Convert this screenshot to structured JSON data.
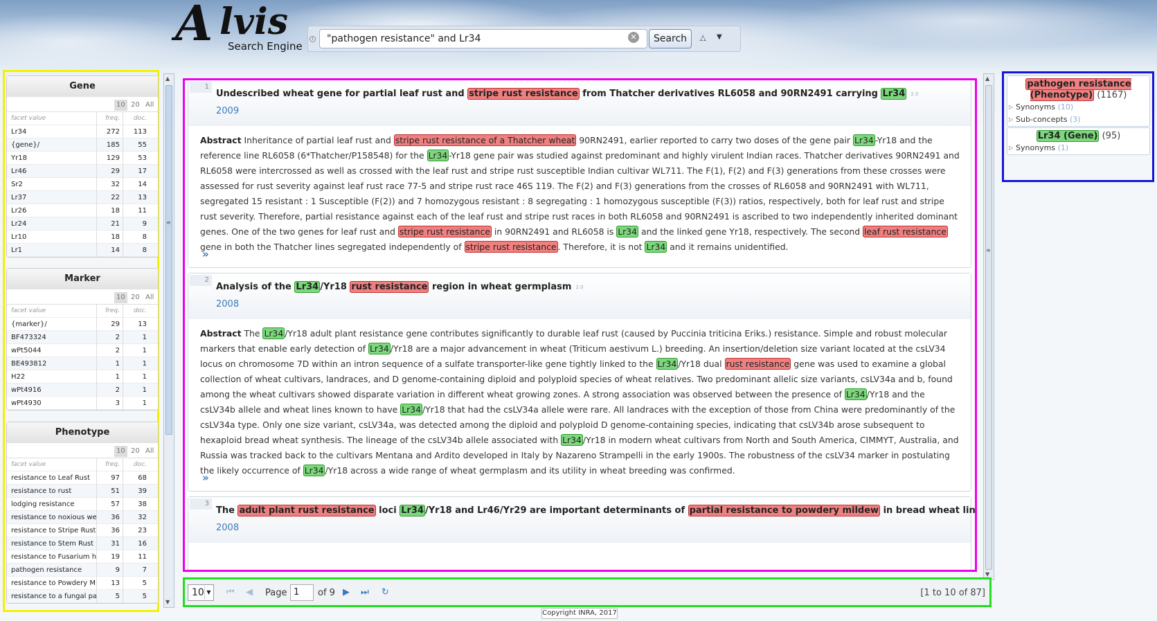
{
  "app": {
    "logo_letter": "A",
    "logo_word": "lvis",
    "logo_sub": "Search Engine"
  },
  "search": {
    "query": "\"pathogen resistance\" and Lr34",
    "button": "Search",
    "info_icon": "info-icon",
    "clear_icon": "clear-icon",
    "tree_icon": "hierarchy-icon"
  },
  "facets": [
    {
      "title": "Gene",
      "toggles": [
        "10",
        "20",
        "All"
      ],
      "headers": [
        "facet value",
        "freq.",
        "doc."
      ],
      "rows": [
        [
          "Lr34",
          "272",
          "113"
        ],
        [
          "{gene}/",
          "185",
          "55"
        ],
        [
          "Yr18",
          "129",
          "53"
        ],
        [
          "Lr46",
          "29",
          "17"
        ],
        [
          "Sr2",
          "32",
          "14"
        ],
        [
          "Lr37",
          "22",
          "13"
        ],
        [
          "Lr26",
          "18",
          "11"
        ],
        [
          "Lr24",
          "21",
          "9"
        ],
        [
          "Lr10",
          "18",
          "8"
        ],
        [
          "Lr1",
          "14",
          "8"
        ]
      ]
    },
    {
      "title": "Marker",
      "toggles": [
        "10",
        "20",
        "All"
      ],
      "headers": [
        "facet value",
        "freq.",
        "doc."
      ],
      "rows": [
        [
          "{marker}/",
          "29",
          "13"
        ],
        [
          "BF473324",
          "2",
          "1"
        ],
        [
          "wPt5044",
          "2",
          "1"
        ],
        [
          "BE493812",
          "1",
          "1"
        ],
        [
          "H22",
          "1",
          "1"
        ],
        [
          "wPt4916",
          "2",
          "1"
        ],
        [
          "wPt4930",
          "3",
          "1"
        ]
      ]
    },
    {
      "title": "Phenotype",
      "toggles": [
        "10",
        "20",
        "All"
      ],
      "headers": [
        "facet value",
        "freq.",
        "doc."
      ],
      "rows": [
        [
          "resistance to Leaf Rust",
          "97",
          "68"
        ],
        [
          "resistance to rust",
          "51",
          "39"
        ],
        [
          "lodging resistance",
          "57",
          "38"
        ],
        [
          "resistance to noxious wee",
          "36",
          "32"
        ],
        [
          "resistance to Stripe Rust",
          "36",
          "23"
        ],
        [
          "resistance to Stem Rust",
          "31",
          "16"
        ],
        [
          "resistance to Fusarium he",
          "19",
          "11"
        ],
        [
          "pathogen resistance",
          "9",
          "7"
        ],
        [
          "resistance to Powdery Mi",
          "13",
          "5"
        ],
        [
          "resistance to a fungal pat",
          "5",
          "5"
        ]
      ]
    }
  ],
  "documents": [
    {
      "num": "1",
      "title_parts": [
        {
          "t": "Undescribed wheat gene for partial leaf rust and ",
          "h": ""
        },
        {
          "t": "stripe rust resistance",
          "h": "r"
        },
        {
          "t": " from Thatcher derivatives RL6058 and 90RN2491 carrying ",
          "h": ""
        },
        {
          "t": "Lr34",
          "h": "g"
        }
      ],
      "score": "2.0",
      "year": "2009",
      "abstract_label": "Abstract",
      "abstract_parts": [
        {
          "t": " Inheritance of partial leaf rust and ",
          "h": ""
        },
        {
          "t": "stripe rust resistance of a Thatcher wheat",
          "h": "r"
        },
        {
          "t": " 90RN2491, earlier reported to carry two doses of the gene pair ",
          "h": ""
        },
        {
          "t": "Lr34",
          "h": "g"
        },
        {
          "t": "-Yr18 and the reference line RL6058 (6*Thatcher/P158548) for the ",
          "h": ""
        },
        {
          "t": "Lr34",
          "h": "g"
        },
        {
          "t": "-Yr18 gene pair was studied against predominant and highly virulent Indian races. Thatcher derivatives 90RN2491 and RL6058 were intercrossed as well as crossed with the leaf rust and stripe rust susceptible Indian cultivar WL711. The F(1), F(2) and F(3) generations from these crosses were assessed for rust severity against leaf rust race 77-5 and stripe rust race 46S 119. The F(2) and F(3) generations from the crosses of RL6058 and 90RN2491 with WL711, segregated 15 resistant : 1 Susceptible (F(2)) and 7 homozygous resistant : 8 segregating : 1 homozygous susceptible (F(3)) ratios, respectively, both for leaf rust and stripe rust severity. Therefore, partial resistance against each of the leaf rust and stripe rust races in both RL6058 and 90RN2491 is ascribed to two independently inherited dominant genes. One of the two genes for leaf rust and ",
          "h": ""
        },
        {
          "t": "stripe rust resistance",
          "h": "r"
        },
        {
          "t": " in 90RN2491 and RL6058 is ",
          "h": ""
        },
        {
          "t": "Lr34",
          "h": "g"
        },
        {
          "t": " and the linked gene Yr18, respectively. The second ",
          "h": ""
        },
        {
          "t": "leaf rust resistance",
          "h": "r"
        },
        {
          "t": " gene in both the Thatcher lines segregated independently of ",
          "h": ""
        },
        {
          "t": "stripe rust resistance",
          "h": "r"
        },
        {
          "t": ". Therefore, it is not ",
          "h": ""
        },
        {
          "t": "Lr34",
          "h": "g"
        },
        {
          "t": " and it remains unidentified.",
          "h": ""
        }
      ]
    },
    {
      "num": "2",
      "title_parts": [
        {
          "t": "Analysis of the ",
          "h": ""
        },
        {
          "t": "Lr34",
          "h": "g"
        },
        {
          "t": "/Yr18 ",
          "h": ""
        },
        {
          "t": "rust resistance",
          "h": "r"
        },
        {
          "t": " region in wheat germplasm",
          "h": ""
        }
      ],
      "score": "2.0",
      "year": "2008",
      "abstract_label": "Abstract",
      "abstract_parts": [
        {
          "t": " The ",
          "h": ""
        },
        {
          "t": "Lr34",
          "h": "g"
        },
        {
          "t": "/Yr18 adult plant resistance gene contributes significantly to durable leaf rust (caused by Puccinia triticina Eriks.) resistance. Simple and robust molecular markers that enable early detection of ",
          "h": ""
        },
        {
          "t": "Lr34",
          "h": "g"
        },
        {
          "t": "/Yr18 are a major advancement in wheat (Triticum aestivum L.) breeding. An insertion/deletion size variant located at the csLV34 locus on chromosome 7D within an intron sequence of a sulfate transporter-like gene tightly linked to the ",
          "h": ""
        },
        {
          "t": "Lr34",
          "h": "g"
        },
        {
          "t": "/Yr18 dual ",
          "h": ""
        },
        {
          "t": "rust resistance",
          "h": "r"
        },
        {
          "t": " gene was used to examine a global collection of wheat cultivars, landraces, and D genome-containing diploid and polyploid species of wheat relatives. Two predominant allelic size variants, csLV34a and b, found among the wheat cultivars showed disparate variation in different wheat growing zones. A strong association was observed between the presence of ",
          "h": ""
        },
        {
          "t": "Lr34",
          "h": "g"
        },
        {
          "t": "/Yr18 and the csLV34b allele and wheat lines known to have ",
          "h": ""
        },
        {
          "t": "Lr34",
          "h": "g"
        },
        {
          "t": "/Yr18 that had the csLV34a allele were rare. All landraces with the exception of those from China were predominantly of the csLV34a type. Only one size variant, csLV34a, was detected among the diploid and polyploid D genome-containing species, indicating that csLV34b arose subsequent to hexaploid bread wheat synthesis. The lineage of the csLV34b allele associated with ",
          "h": ""
        },
        {
          "t": "Lr34",
          "h": "g"
        },
        {
          "t": "/Yr18 in modern wheat cultivars from North and South America, CIMMYT, Australia, and Russia was tracked back to the cultivars Mentana and Ardito developed in Italy by Nazareno Strampelli in the early 1900s. The robustness of the csLV34 marker in postulating the likely occurrence of ",
          "h": ""
        },
        {
          "t": "Lr34",
          "h": "g"
        },
        {
          "t": "/Yr18 across a wide range of wheat germplasm and its utility in wheat breeding was confirmed.",
          "h": ""
        }
      ]
    },
    {
      "num": "3",
      "title_parts": [
        {
          "t": "The ",
          "h": ""
        },
        {
          "t": "adult plant rust resistance",
          "h": "r"
        },
        {
          "t": " loci ",
          "h": ""
        },
        {
          "t": "Lr34",
          "h": "g"
        },
        {
          "t": "/Yr18 and Lr46/Yr29 are important determinants of ",
          "h": ""
        },
        {
          "t": "partial resistance to powdery mildew",
          "h": "r"
        },
        {
          "t": " in bread wheat line Saar",
          "h": ""
        }
      ],
      "score": "2.0",
      "year": "2008"
    }
  ],
  "more_icon": "expand-double-chevron-icon",
  "pager": {
    "page_size": "10",
    "page_label": "Page",
    "page_value": "1",
    "of_label": "of 9",
    "range": "[1 to 10 of 87]",
    "icons": [
      "first-page-icon",
      "prev-page-icon",
      "next-page-icon",
      "last-page-icon",
      "refresh-icon"
    ]
  },
  "copyright": "Copyright INRA, 2017",
  "concepts": [
    {
      "name": "pathogen resistance (Phenotype)",
      "count": "(1167)",
      "highlight": "r",
      "subs": [
        {
          "label": "Synonyms",
          "count": "(10)"
        },
        {
          "label": "Sub-concepts",
          "count": "(3)"
        }
      ]
    },
    {
      "name": "Lr34 (Gene)",
      "count": "(95)",
      "highlight": "g",
      "subs": [
        {
          "label": "Synonyms",
          "count": "(1)"
        }
      ]
    }
  ],
  "colors": {
    "phenotype_highlight": "#f08080",
    "gene_highlight": "#7dd87d",
    "link_blue": "#3a78c0",
    "facet_box": "#f2f200",
    "results_box": "#ee00ee",
    "pager_box": "#22dd22",
    "concepts_box": "#1515d8"
  }
}
